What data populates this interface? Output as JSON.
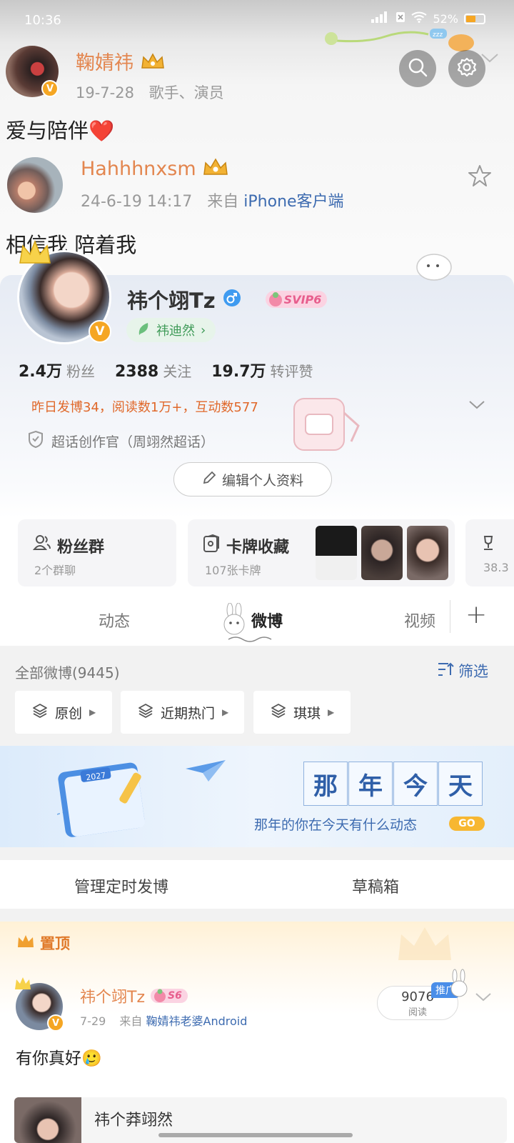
{
  "status_bar": {
    "time": "10:36",
    "battery": "52%",
    "signal_icon": "signal-icon",
    "wifi_icon": "wifi-icon"
  },
  "feed": {
    "post1": {
      "author": "鞠婧祎",
      "date": "19-7-28",
      "tags": "歌手、演员",
      "text": "爱与陪伴❤️"
    },
    "post2": {
      "author": "Hahhhnxsm",
      "date": "24-6-19 14:17",
      "source_prefix": "来自",
      "source": "iPhone客户端",
      "text": "相信我 陪着我"
    }
  },
  "profile": {
    "name": "祎个翊Tz",
    "gender_icon": "male-icon",
    "svip": "SVIP6",
    "fan_tag": "祎迪然",
    "stats": [
      {
        "value": "2.4万",
        "label": "粉丝"
      },
      {
        "value": "2388",
        "label": "关注"
      },
      {
        "value": "19.7万",
        "label": "转评赞"
      }
    ],
    "yesterday": "昨日发博34，阅读数1万+，互动数577",
    "role": "超话创作官（周翊然超话）",
    "edit_label": "编辑个人资料"
  },
  "mini_cards": {
    "fans_group": {
      "title": "粉丝群",
      "sub": "2个群聊"
    },
    "card_collect": {
      "title": "卡牌收藏",
      "sub": "107张卡牌"
    },
    "partial_sub": "38.3"
  },
  "tabs": {
    "items": [
      "动态",
      "微博",
      "视频"
    ],
    "active": "微博",
    "add": "+"
  },
  "weibo_list": {
    "count_label": "全部微博(9445)",
    "filter_label": "筛选",
    "chips": [
      "原创",
      "近期热门",
      "琪琪"
    ]
  },
  "banner": {
    "chars": [
      "那",
      "年",
      "今",
      "天"
    ],
    "sub": "那年的你在今天有什么动态",
    "go": "GO",
    "calendar_year": "2027"
  },
  "actions": {
    "scheduled": "管理定时发博",
    "drafts": "草稿箱"
  },
  "pinned_post": {
    "pin_label": "置顶",
    "author": "祎个翊Tz",
    "svip": "S6",
    "date": "7-29",
    "source_prefix": "来自",
    "source": "鞠婧祎老婆Android",
    "promo": "推广",
    "read_count": "9076",
    "read_label": "阅读",
    "text": "有你真好🥲",
    "next_preview": "祎个莽翊然"
  },
  "colors": {
    "accent_orange": "#e3864f",
    "link_blue": "#3d6bb0",
    "gold": "#f5a623"
  }
}
